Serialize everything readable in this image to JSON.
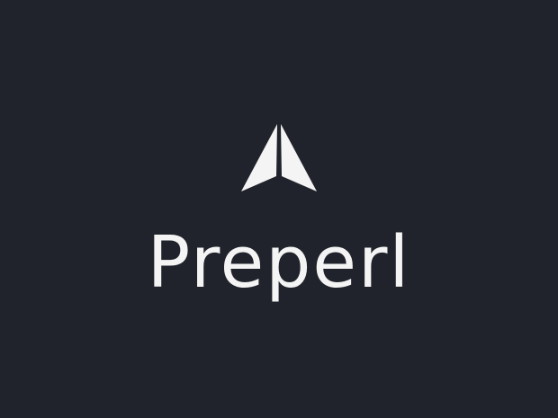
{
  "brand": {
    "name": "Preperl",
    "icon": "arrowhead-logo-icon"
  },
  "colors": {
    "background": "#20232b",
    "foreground": "#f4f4f4"
  }
}
